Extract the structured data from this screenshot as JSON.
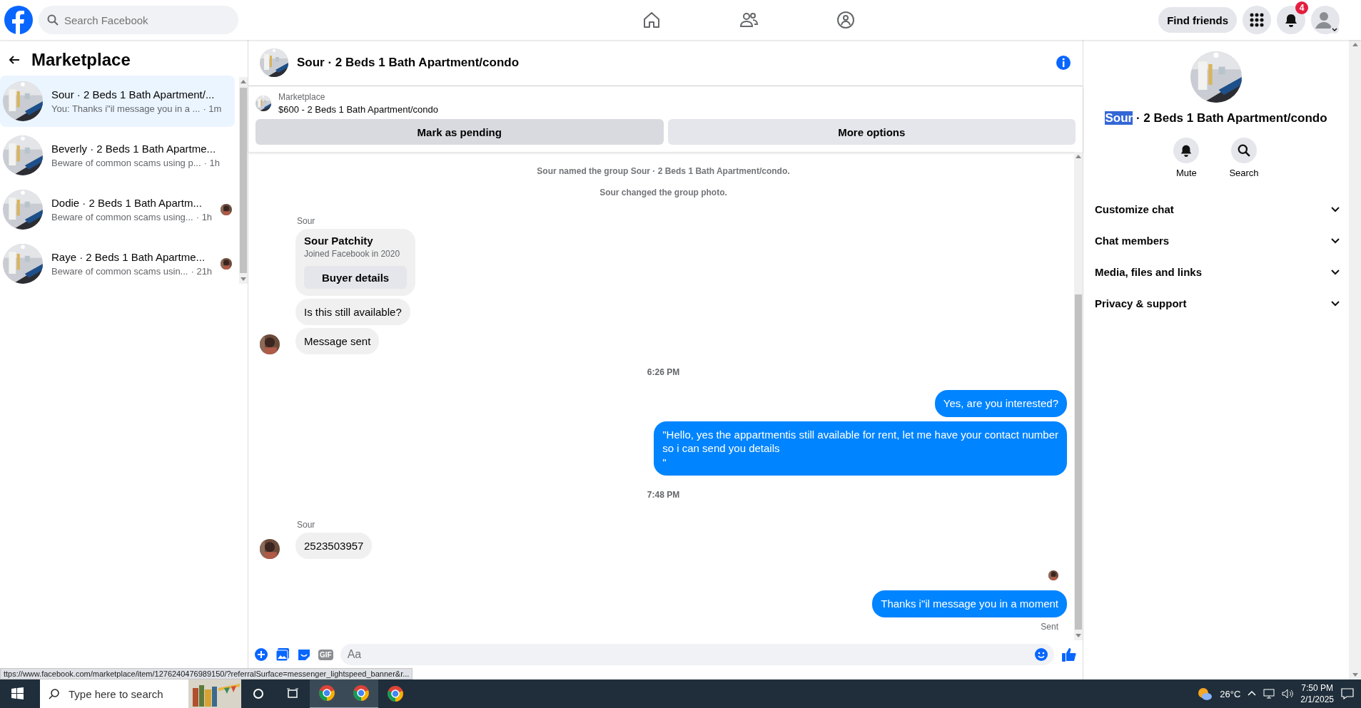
{
  "topbar": {
    "search": {
      "placeholder": "Search Facebook"
    },
    "find_friends": "Find friends",
    "notification_count": "4"
  },
  "sidebar": {
    "title": "Marketplace",
    "conversations": [
      {
        "title": "Sour · 2 Beds 1 Bath Apartment/...",
        "preview": "You: Thanks i\"il message you in a ...",
        "time": "· 1m",
        "selected": true,
        "seen": false
      },
      {
        "title": "Beverly · 2 Beds 1 Bath Apartme...",
        "preview": "Beware of common scams using p...",
        "time": "· 1h",
        "selected": false,
        "seen": false
      },
      {
        "title": "Dodie · 2 Beds 1 Bath Apartm...",
        "preview": "Beware of common scams using...",
        "time": "· 1h",
        "selected": false,
        "seen": true
      },
      {
        "title": "Raye · 2 Beds 1 Bath Apartme...",
        "preview": "Beware of common scams usin...",
        "time": "· 21h",
        "selected": false,
        "seen": true
      }
    ]
  },
  "chat": {
    "title": "Sour · 2 Beds 1 Bath Apartment/condo",
    "listing": {
      "source": "Marketplace",
      "item": "$600 - 2 Beds 1 Bath Apartment/condo",
      "buttons": [
        "Mark as pending",
        "More options"
      ]
    },
    "messages": [
      {
        "kind": "system",
        "text": "Sour named the group Sour · 2 Beds 1 Bath Apartment/condo."
      },
      {
        "kind": "system",
        "text": "Sour changed the group photo."
      },
      {
        "kind": "sender",
        "text": "Sour"
      },
      {
        "kind": "card",
        "name": "Sour Patchity",
        "subtitle": "Joined Facebook in 2020",
        "button": "Buyer details"
      },
      {
        "kind": "incoming",
        "text": "Is this still available?",
        "avatar": false
      },
      {
        "kind": "incoming",
        "text": "Message sent",
        "avatar": true
      },
      {
        "kind": "time",
        "text": "6:26 PM"
      },
      {
        "kind": "outgoing",
        "text": "Yes, are you interested?"
      },
      {
        "kind": "outgoing",
        "text": "\"Hello, yes the appartmentis still available for rent, let me have your contact number\nso i can send you details\n\""
      },
      {
        "kind": "time",
        "text": "7:48 PM"
      },
      {
        "kind": "sender",
        "text": "Sour"
      },
      {
        "kind": "incoming",
        "text": "2523503957",
        "avatar": true
      },
      {
        "kind": "seen_avatar"
      },
      {
        "kind": "outgoing",
        "text": "Thanks i\"il message you in a moment"
      },
      {
        "kind": "status",
        "text": "Sent"
      }
    ],
    "composer": {
      "placeholder": "Aa",
      "gif": "GIF"
    }
  },
  "details": {
    "title_selected": "Sour",
    "title_rest": "· 2 Beds 1 Bath Apartment/condo",
    "actions": [
      "Mute",
      "Search"
    ],
    "sections": [
      "Customize chat",
      "Chat members",
      "Media, files and links",
      "Privacy & support"
    ]
  },
  "status_url": "ttps://www.facebook.com/marketplace/item/1276240476989150/?referralSurface=messenger_lightspeed_banner&r...",
  "taskbar": {
    "search": "Type here to search",
    "temperature": "26°C",
    "time": "7:50 PM",
    "date": "2/1/2025"
  }
}
